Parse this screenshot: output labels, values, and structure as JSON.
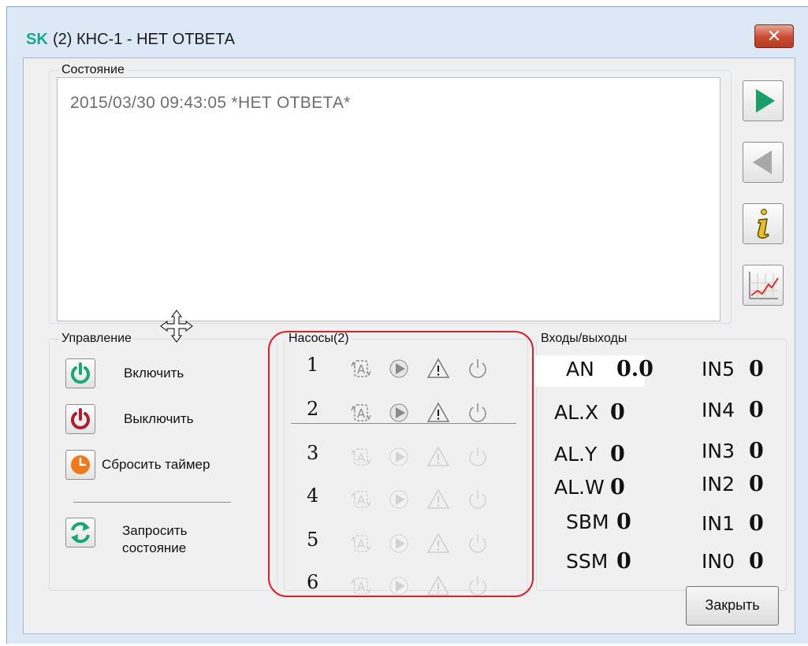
{
  "window": {
    "logo": "SK",
    "title": "(2) КНС-1 - НЕТ ОТВЕТА",
    "close_glyph": "✕"
  },
  "status": {
    "group_label": "Состояние",
    "message": "2015/03/30 09:43:05 *НЕТ ОТВЕТА*"
  },
  "side_buttons": [
    {
      "name": "forward-button",
      "icon": "play-right-icon",
      "color": "#1a9e6a"
    },
    {
      "name": "back-button",
      "icon": "play-left-icon",
      "color": "#a8a8a8"
    },
    {
      "name": "info-button",
      "icon": "info-icon",
      "color": "#e8c020"
    },
    {
      "name": "chart-button",
      "icon": "chart-icon",
      "color": "#e03030"
    }
  ],
  "control": {
    "group_label": "Управление",
    "on_label": "Включить",
    "off_label": "Выключить",
    "reset_timer_label": "Сбросить таймер",
    "request_status_label_1": "Запросить",
    "request_status_label_2": "состояние"
  },
  "pumps": {
    "group_label": "Насосы(2)",
    "rows": [
      {
        "num": "1",
        "active": true
      },
      {
        "num": "2",
        "active": true
      },
      {
        "num": "3",
        "active": false
      },
      {
        "num": "4",
        "active": false
      },
      {
        "num": "5",
        "active": false
      },
      {
        "num": "6",
        "active": false
      }
    ],
    "icons": [
      "auto-icon",
      "play-icon",
      "warning-icon",
      "power-icon"
    ]
  },
  "io": {
    "group_label": "Входы/выходы",
    "left": [
      {
        "name": "AN",
        "value": "0.0"
      },
      {
        "name": "AL.X",
        "value": "0"
      },
      {
        "name": "AL.Y",
        "value": "0"
      },
      {
        "name": "AL.W",
        "value": "0"
      },
      {
        "name": "SBM",
        "value": "0"
      },
      {
        "name": "SSM",
        "value": "0"
      }
    ],
    "right": [
      {
        "name": "IN5",
        "value": "0"
      },
      {
        "name": "IN4",
        "value": "0"
      },
      {
        "name": "IN3",
        "value": "0"
      },
      {
        "name": "IN2",
        "value": "0"
      },
      {
        "name": "IN1",
        "value": "0"
      },
      {
        "name": "IN0",
        "value": "0"
      }
    ]
  },
  "footer": {
    "close_label": "Закрыть"
  },
  "colors": {
    "on_icon": "#1aa878",
    "off_icon": "#b01e2c",
    "timer_icon": "#f07a1a",
    "refresh_icon": "#18a878",
    "highlight": "#e01e2a"
  }
}
